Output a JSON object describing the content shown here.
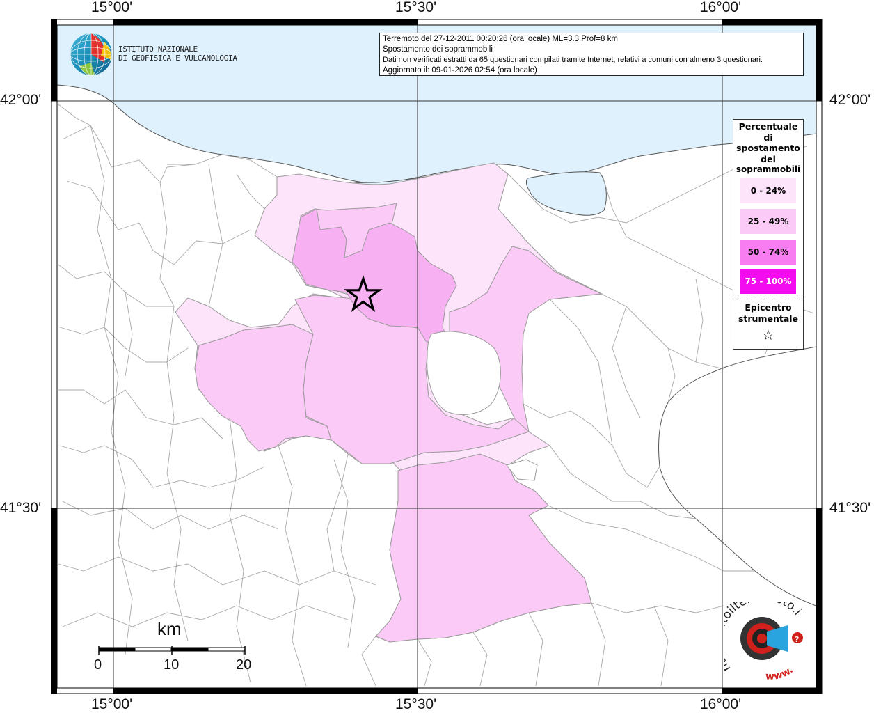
{
  "map": {
    "title_lines": [
      "Terremoto del 27-12-2011 00:20:26 (ora locale) ML=3.3 Prof=8 km",
      "Spostamento dei soprammobili",
      "Dati non verificati estratti da 65 questionari compilati tramite Internet, relativi a comuni con almeno 3 questionari.",
      "Aggiornato il: 09-01-2026 02:54 (ora locale)"
    ],
    "institute": {
      "line1": "ISTITUTO NAZIONALE",
      "line2": "DI GEOFISICA E VULCANOLOGIA"
    },
    "lon_ticks": [
      "15°00'",
      "15°30'",
      "16°00'"
    ],
    "lat_ticks": [
      "42°00'",
      "41°30'"
    ],
    "legend": {
      "title": [
        "Percentuale",
        "di",
        "spostamento",
        "dei",
        "soprammobili"
      ],
      "classes": [
        {
          "label": "0 - 24%",
          "color": "#fde4fb"
        },
        {
          "label": "25 - 49%",
          "color": "#fbcaf6"
        },
        {
          "label": "50 - 74%",
          "color": "#f77df0"
        },
        {
          "label": "75 - 100%",
          "color": "#f40cf0"
        }
      ],
      "epicenter_label": [
        "Epicentro",
        "strumentale"
      ],
      "epicenter_symbol": "☆"
    },
    "scale": {
      "unit": "km",
      "labels": [
        "0",
        "10",
        "20"
      ]
    },
    "website_logo": {
      "text": "haisentitoilterremoto.it",
      "prefix": "www.",
      "mark": "?"
    },
    "colors": {
      "sea": "#dff1fd",
      "land": "#ffffff",
      "borders": "#9a9a9a",
      "class_0_24": "#fde4fb",
      "class_25_49": "#fbcaf6",
      "class_50_74": "#f77df0"
    }
  }
}
